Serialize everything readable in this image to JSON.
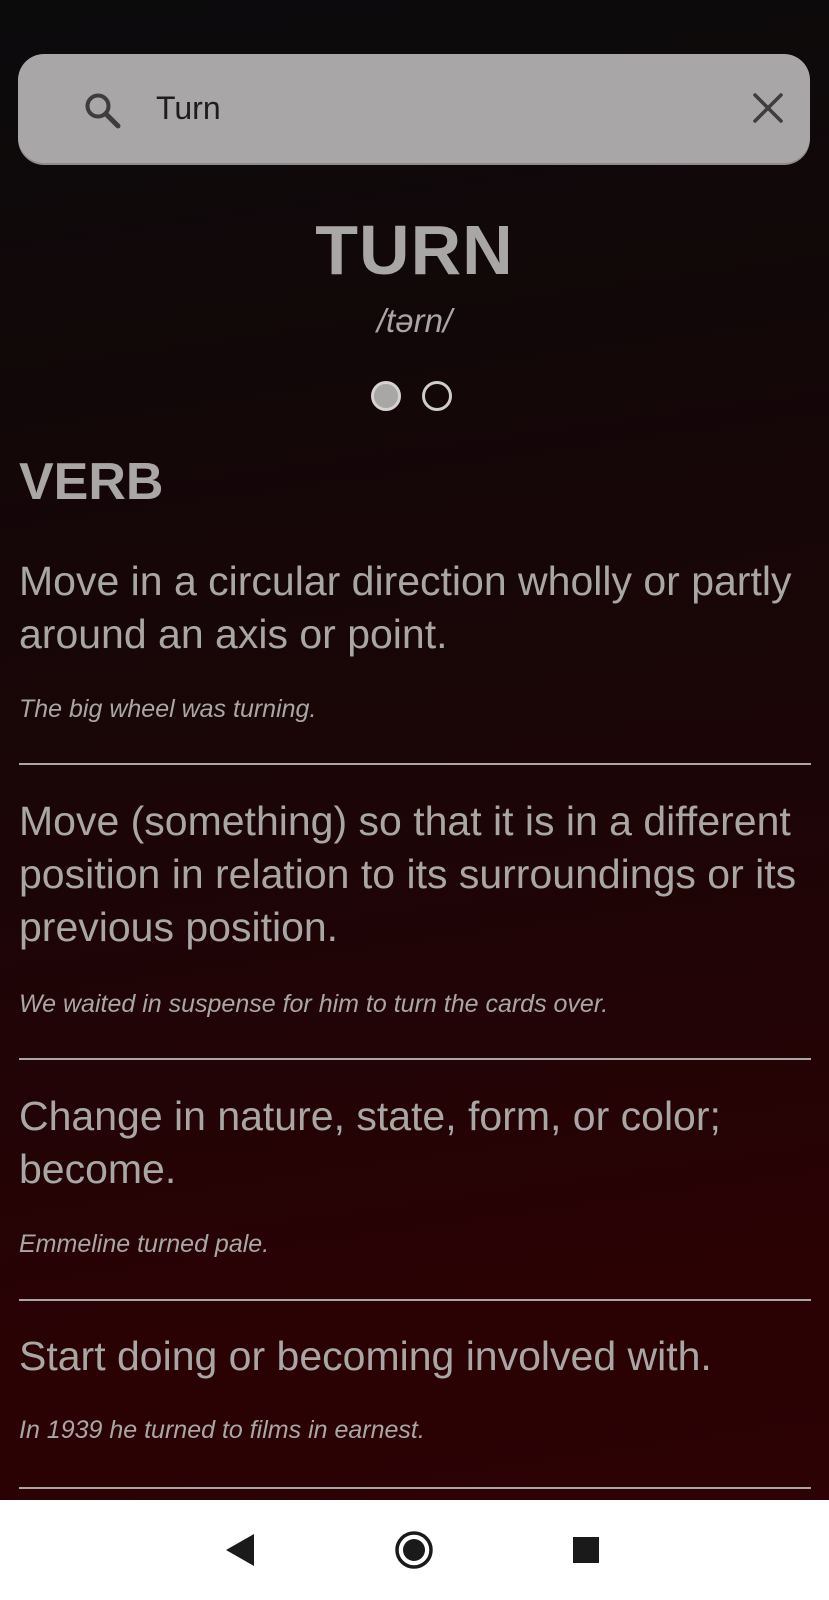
{
  "search": {
    "query": "Turn",
    "search_icon": "search-icon",
    "clear_icon": "close-icon"
  },
  "entry": {
    "headword": "TURN",
    "phonetic": "/tərn/",
    "pages": {
      "count": 2,
      "active": 1
    },
    "part_of_speech": "VERB",
    "senses": [
      {
        "definition": "Move in a circular direction wholly or partly around an axis or point.",
        "example": "The big wheel was turning."
      },
      {
        "definition": "Move (something) so that it is in a different position in relation to its surroundings or its previous position.",
        "example": "We waited in suspense for him to turn the cards over."
      },
      {
        "definition": "Change in nature, state, form, or color; become.",
        "example": "Emmeline turned pale."
      },
      {
        "definition": "Start doing or becoming involved with.",
        "example": "In 1939 he turned to films in earnest."
      }
    ]
  },
  "navbar": {
    "back_icon": "back-icon",
    "home_icon": "home-icon",
    "recents_icon": "recents-icon"
  },
  "colors": {
    "text": "#a9a6a6",
    "search_bg": "#a8a6a6",
    "background_top": "#0b0b0c",
    "background_bottom": "#2c0205",
    "navbar_bg": "#ffffff",
    "nav_icons": "#1a1a1a"
  }
}
